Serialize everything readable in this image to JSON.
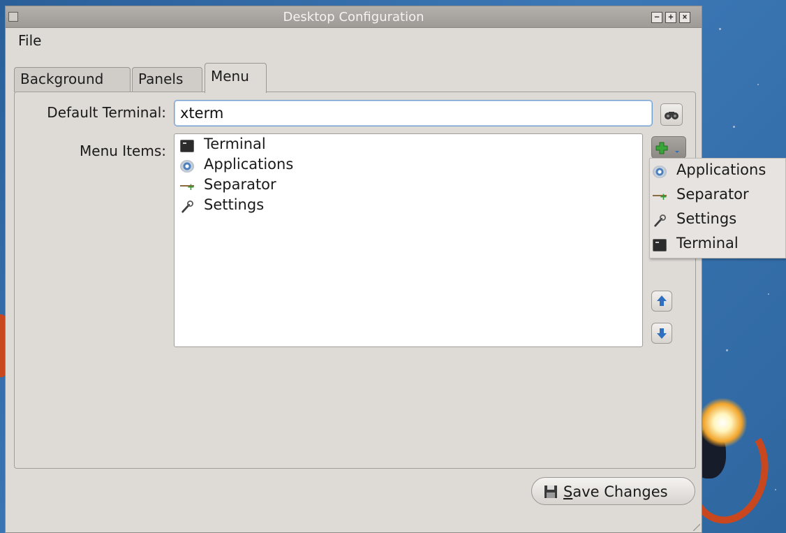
{
  "window": {
    "title": "Desktop Configuration",
    "menu": [
      "File"
    ]
  },
  "tabs": [
    {
      "label": "Background",
      "active": false
    },
    {
      "label": "Panels",
      "active": false
    },
    {
      "label": "Menu",
      "active": true
    }
  ],
  "form": {
    "default_terminal_label": "Default Terminal:",
    "default_terminal_value": "xterm",
    "menu_items_label": "Menu Items:"
  },
  "menu_items": [
    {
      "label": "Terminal",
      "icon": "terminal-icon"
    },
    {
      "label": "Applications",
      "icon": "applications-gear-icon"
    },
    {
      "label": "Separator",
      "icon": "separator-icon"
    },
    {
      "label": "Settings",
      "icon": "wrench-icon"
    }
  ],
  "add_popup": [
    {
      "label": "Applications",
      "icon": "applications-gear-icon"
    },
    {
      "label": "Separator",
      "icon": "separator-icon"
    },
    {
      "label": "Settings",
      "icon": "wrench-icon"
    },
    {
      "label": "Terminal",
      "icon": "terminal-icon"
    }
  ],
  "buttons": {
    "save_mnemonic": "S",
    "save_rest": "ave Changes"
  },
  "colors": {
    "window_bg": "#dedad6",
    "titlebar": "#a8a4a0",
    "focus_border": "#6f9ed0",
    "add_green": "#3aa53a",
    "arrow_blue": "#2f6fc0"
  }
}
